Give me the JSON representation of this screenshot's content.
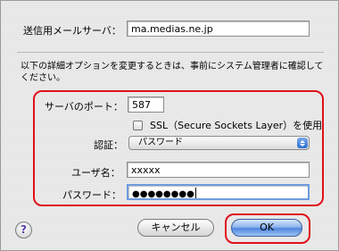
{
  "server": {
    "label": "送信用メールサーバ：",
    "value": "ma.medias.ne.jp"
  },
  "description": "以下の詳細オプションを変更するときは、事前にシステム管理者に確認してください。",
  "port": {
    "label": "サーバのポート：",
    "value": "587"
  },
  "ssl": {
    "label": "SSL（Secure Sockets Layer）を使用",
    "checked": false
  },
  "auth": {
    "label": "認証：",
    "value": "パスワード"
  },
  "username": {
    "label": "ユーザ名：",
    "value": "xxxxx"
  },
  "password": {
    "label": "パスワード：",
    "value": "●●●●●●●●"
  },
  "buttons": {
    "help": "?",
    "cancel": "キャンセル",
    "ok": "OK"
  },
  "colors": {
    "highlight": "#e0101a",
    "default_button": "#4f86de"
  }
}
